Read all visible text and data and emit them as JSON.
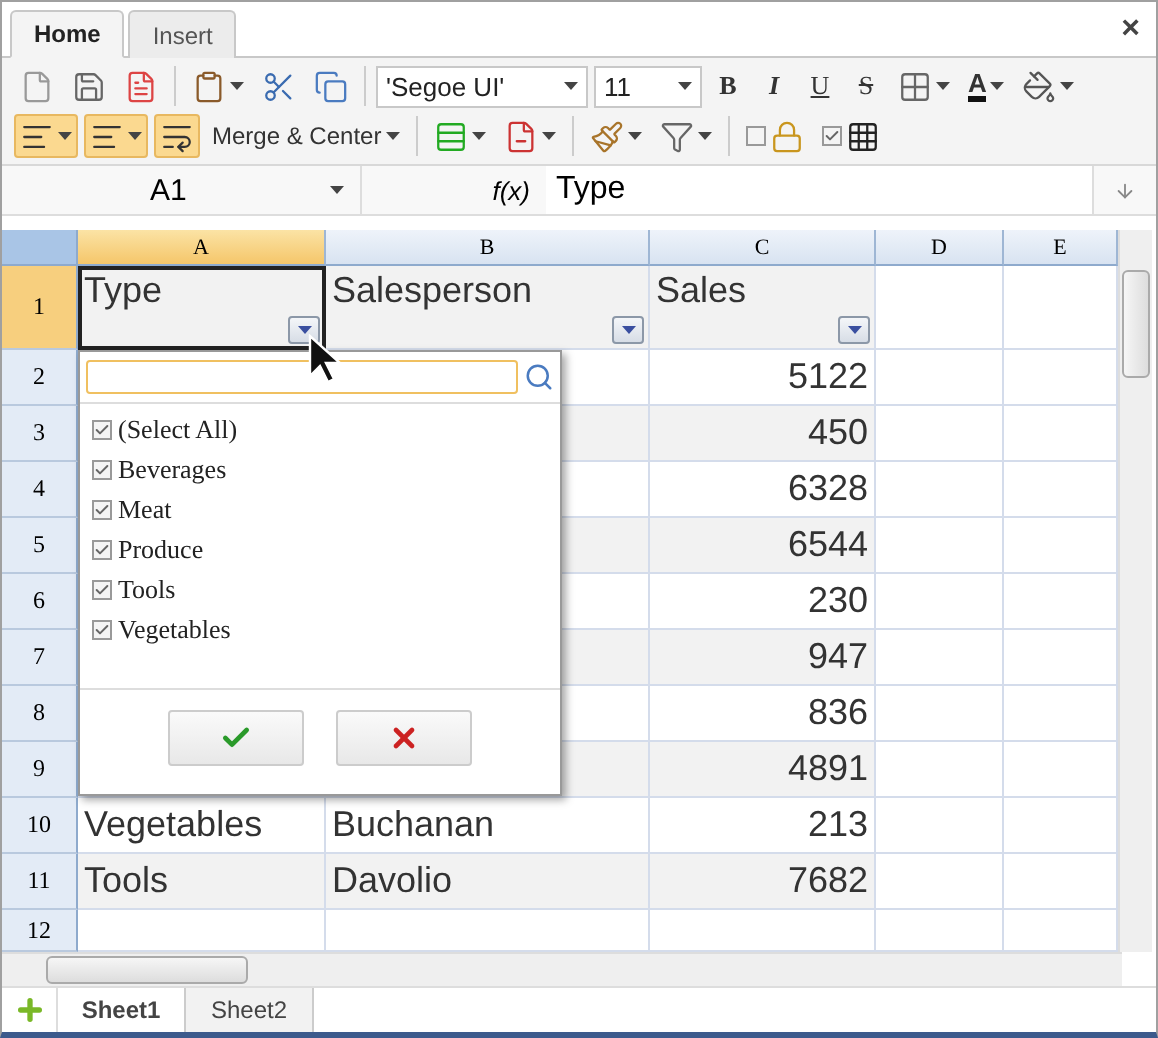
{
  "tabs": [
    {
      "label": "Home",
      "selected": true
    },
    {
      "label": "Insert",
      "selected": false
    }
  ],
  "close": "×",
  "toolbar": {
    "font": "'Segoe UI'",
    "size": "11",
    "format_buttons": [
      "B",
      "I",
      "U",
      "S"
    ],
    "font_color": "A",
    "merge": "Merge & Center"
  },
  "formula_bar": {
    "cell": "A1",
    "fx": "f(x)",
    "value": "Type"
  },
  "columns": [
    {
      "label": "A",
      "selected": true
    },
    {
      "label": "B",
      "selected": false
    },
    {
      "label": "C",
      "selected": false
    },
    {
      "label": "D",
      "selected": false
    },
    {
      "label": "E",
      "selected": false
    }
  ],
  "rows": [
    {
      "label": "1",
      "selected": true,
      "kind": "header",
      "a": "Type",
      "b": "Salesperson",
      "c": "Sales"
    },
    {
      "label": "2",
      "selected": false,
      "c": "5122"
    },
    {
      "label": "3",
      "selected": false,
      "c": "450"
    },
    {
      "label": "4",
      "selected": false,
      "c": "6328"
    },
    {
      "label": "5",
      "selected": false,
      "c": "6544"
    },
    {
      "label": "6",
      "selected": false,
      "c": "230"
    },
    {
      "label": "7",
      "selected": false,
      "c": "947"
    },
    {
      "label": "8",
      "selected": false,
      "c": "836"
    },
    {
      "label": "9",
      "selected": false,
      "c": "4891"
    },
    {
      "label": "10",
      "selected": false,
      "a": "Vegetables",
      "b": "Buchanan",
      "c": "213"
    },
    {
      "label": "11",
      "selected": false,
      "a": "Tools",
      "b": "Davolio",
      "c": "7682"
    },
    {
      "label": "12",
      "selected": false
    }
  ],
  "filter": {
    "items": [
      {
        "label": "(Select All)",
        "checked": true
      },
      {
        "label": "Beverages",
        "checked": true
      },
      {
        "label": "Meat",
        "checked": true
      },
      {
        "label": "Produce",
        "checked": true
      },
      {
        "label": "Tools",
        "checked": true
      },
      {
        "label": "Vegetables",
        "checked": true
      }
    ]
  },
  "sheets": [
    {
      "label": "Sheet1",
      "selected": true
    },
    {
      "label": "Sheet2",
      "selected": false
    }
  ]
}
